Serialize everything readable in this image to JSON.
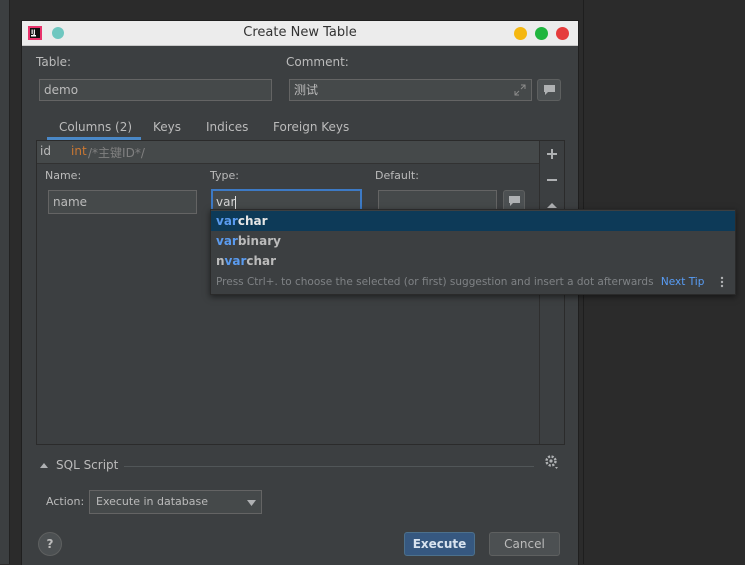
{
  "dialog": {
    "title": "Create New Table"
  },
  "form": {
    "table_label": "Table:",
    "table_value": "demo",
    "comment_label": "Comment:",
    "comment_value": "测试"
  },
  "tabs": [
    {
      "label": "Columns (2)",
      "active": true
    },
    {
      "label": "Keys",
      "active": false
    },
    {
      "label": "Indices",
      "active": false
    },
    {
      "label": "Foreign Keys",
      "active": false
    }
  ],
  "columns_row": {
    "name": "id",
    "type": "int",
    "comment": "/*主键ID*/"
  },
  "column_editor": {
    "name_label": "Name:",
    "name_value": "name",
    "type_label": "Type:",
    "type_value": "var",
    "default_label": "Default:",
    "default_value": ""
  },
  "autocomplete": {
    "items": [
      {
        "pre": "",
        "match": "var",
        "post": "char",
        "selected": true
      },
      {
        "pre": "",
        "match": "var",
        "post": "binary",
        "selected": false
      },
      {
        "pre": "n",
        "match": "var",
        "post": "char",
        "selected": false
      }
    ],
    "tip_text": "Press Ctrl+. to choose the selected (or first) suggestion and insert a dot afterwards",
    "tip_link": "Next Tip"
  },
  "sql_script": {
    "label": "SQL Script"
  },
  "action": {
    "label": "Action:",
    "value": "Execute in database"
  },
  "buttons": {
    "execute": "Execute",
    "cancel": "Cancel",
    "help": "?"
  },
  "colors": {
    "accent": "#4a88c7",
    "dialog_bg": "#3c3f41",
    "selection": "#0d3a58",
    "type_keyword": "#cc7832",
    "comment": "#808080"
  }
}
